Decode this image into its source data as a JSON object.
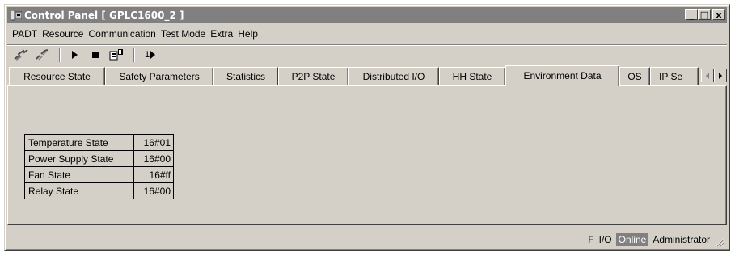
{
  "window": {
    "title": "Control Panel [ GPLC1600_2 ]",
    "minimize": "_",
    "maximize": "□",
    "close": "x"
  },
  "menu": [
    "PADT",
    "Resource",
    "Communication",
    "Test Mode",
    "Extra",
    "Help"
  ],
  "toolbar": {
    "tools": [
      "connect-icon",
      "disconnect-icon",
      "start-icon",
      "stop-icon",
      "download-icon",
      "single-step-icon"
    ],
    "single_step_label": "1"
  },
  "tabs": [
    "Resource State",
    "Safety Parameters",
    "Statistics",
    "P2P State",
    "Distributed I/O",
    "HH State",
    "Environment Data",
    "OS",
    "IP Se"
  ],
  "active_tab": "Environment Data",
  "environment_table": [
    {
      "label": "Temperature State",
      "value": "16#01"
    },
    {
      "label": "Power Supply State",
      "value": "16#00"
    },
    {
      "label": "Fan State",
      "value": "16#ff"
    },
    {
      "label": "Relay State",
      "value": "16#00"
    }
  ],
  "status": {
    "f": "F",
    "io": "I/O",
    "online": "Online",
    "user": "Administrator"
  },
  "colors": {
    "face": "#d4d0c8",
    "titlebar_inactive": "#808080",
    "online_highlight": "#808080"
  }
}
